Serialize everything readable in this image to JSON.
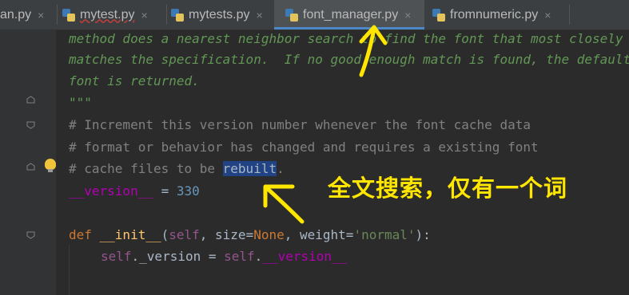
{
  "tabs": [
    {
      "label": "an.py",
      "active": false,
      "icon": "python-file-icon"
    },
    {
      "label": "mytest.py",
      "active": false,
      "icon": "python-file-icon"
    },
    {
      "label": "mytests.py",
      "active": false,
      "icon": "python-file-icon"
    },
    {
      "label": "font_manager.py",
      "active": true,
      "icon": "python-file-icon"
    },
    {
      "label": "fromnumeric.py",
      "active": false,
      "icon": "python-file-icon"
    }
  ],
  "tab_close_glyph": "×",
  "code": {
    "l1": "method does a nearest neighbor search to find the font that most closely",
    "l2": "matches the specification.  If no good enough match is found, the default",
    "l3": "font is returned.",
    "l4": "\"\"\"",
    "l5": "# Increment this version number whenever the font cache data",
    "l6": "# format or behavior has changed and requires a existing font",
    "l7a": "# cache files to be ",
    "l7sel": "rebuilt",
    "l7b": ".",
    "l8_name": "__version__",
    "l8_eq": " = ",
    "l8_val": "330",
    "l10_def": "def ",
    "l10_fn": "__init__",
    "l10_p1": "(",
    "l10_self": "self",
    "l10_c1": ", size=",
    "l10_none": "None",
    "l10_c2": ", ",
    "l10_weight": "weight",
    "l10_eq": "=",
    "l10_str": "'normal'",
    "l10_end": "):",
    "l11_self": "self",
    "l11_attr": "._version = ",
    "l11_self2": "self",
    "l11_dot": ".",
    "l11_dunder": "__version__"
  },
  "annotation_text": "全文搜索，仅有一个词",
  "colors": {
    "background": "#2b2b2b",
    "comment": "#808080",
    "docstring": "#629755",
    "keyword": "#cc7832",
    "selection": "#214283",
    "annotation": "#ffe600",
    "active_tab_underline": "#4a88c7"
  }
}
